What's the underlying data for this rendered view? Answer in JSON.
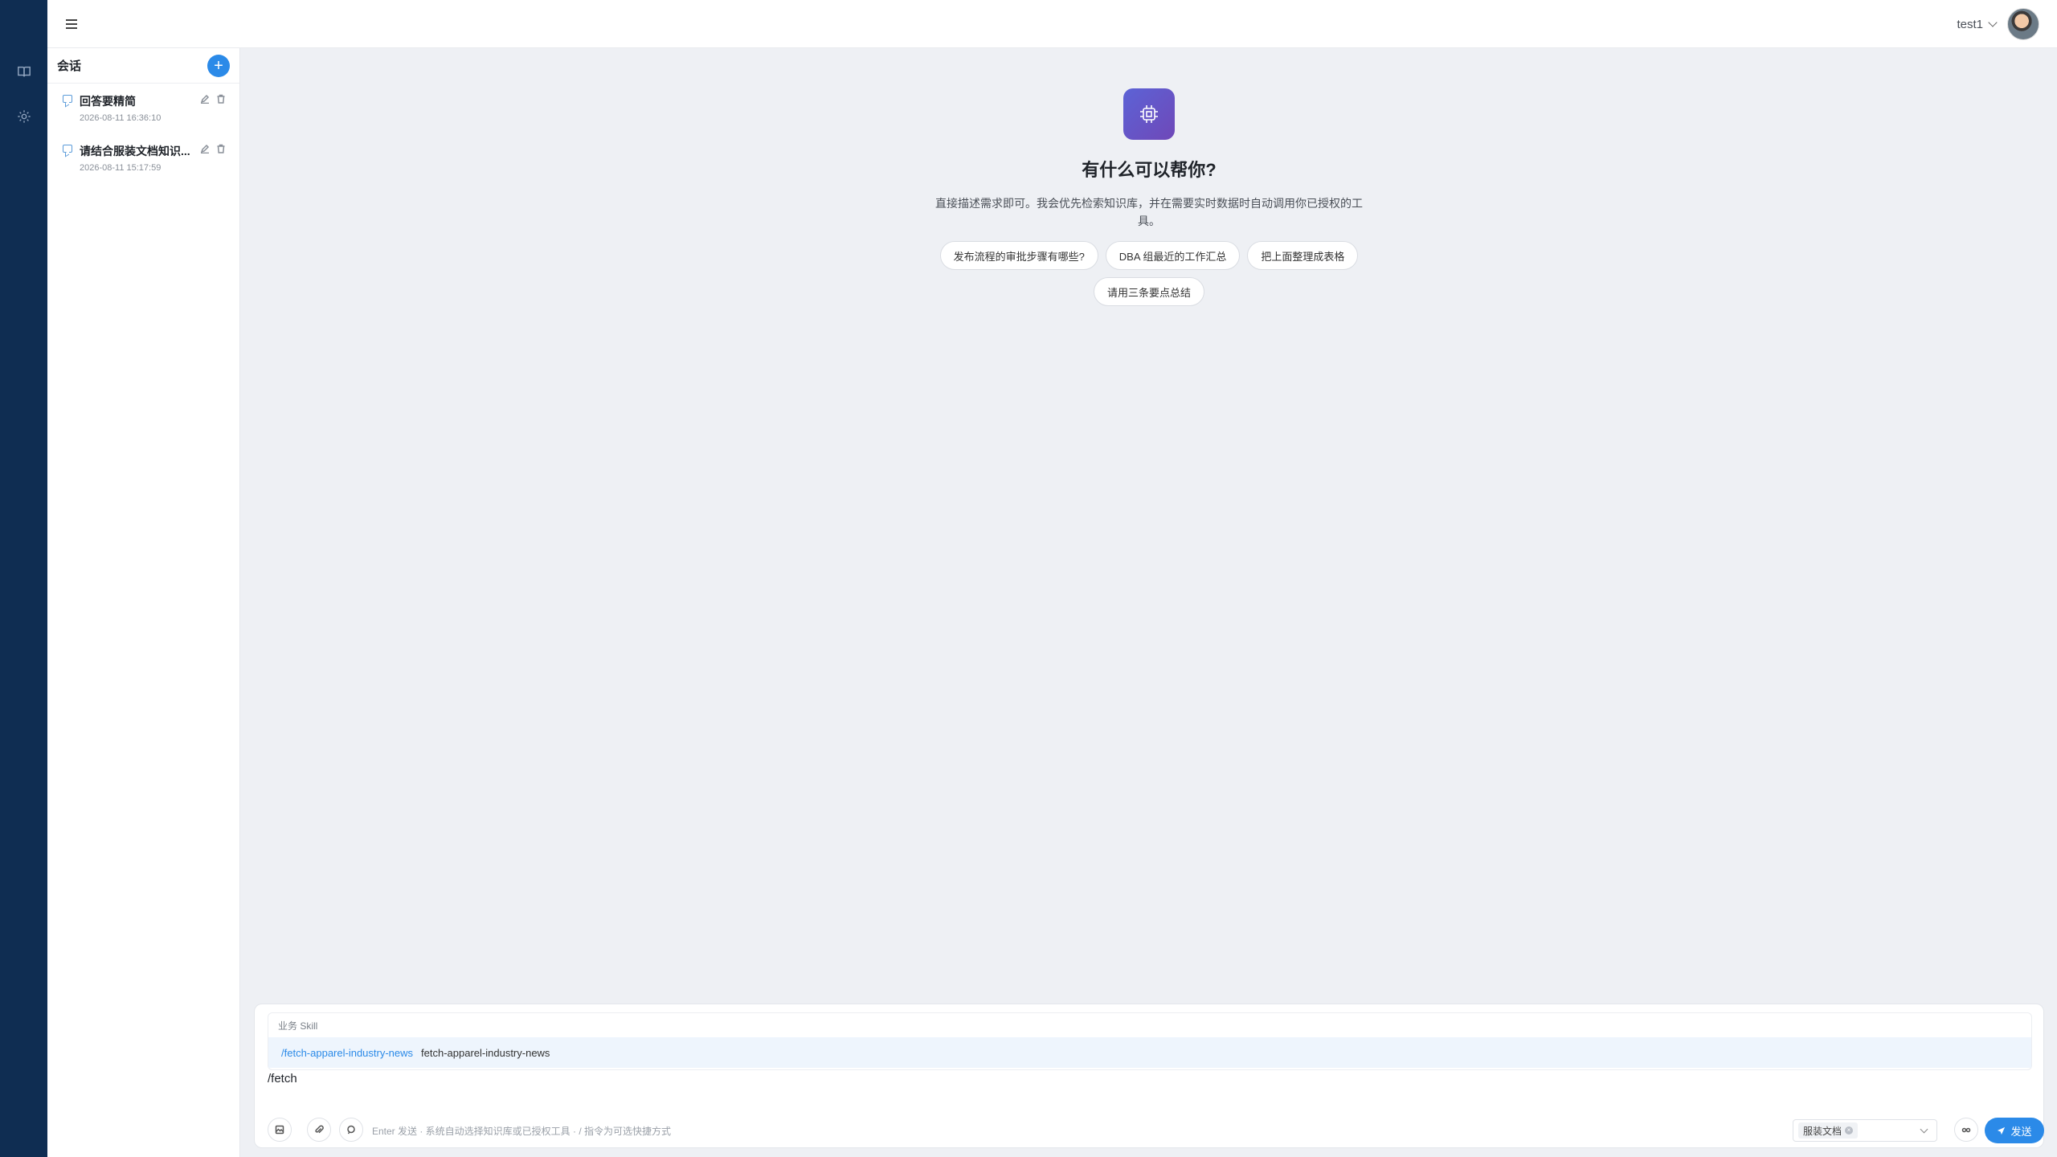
{
  "header": {
    "username": "test1",
    "menu_icon": "menu-icon",
    "avatar_icon": "user-avatar"
  },
  "rail": {
    "items": [
      {
        "icon": "book-icon"
      },
      {
        "icon": "gear-icon"
      }
    ]
  },
  "sessions": {
    "title": "会话",
    "new_label": "+",
    "items": [
      {
        "name": "回答要精简",
        "time": "2026-08-11 16:36:10"
      },
      {
        "name": "请结合服装文档知识...",
        "time": "2026-08-11 15:17:59"
      }
    ]
  },
  "welcome": {
    "icon": "chip-icon",
    "title": "有什么可以帮你?",
    "description": "直接描述需求即可。我会优先检索知识库，并在需要实时数据时自动调用你已授权的工具。",
    "suggestions": [
      "发布流程的审批步骤有哪些?",
      "DBA 组最近的工作汇总",
      "把上面整理成表格",
      "请用三条要点总结"
    ]
  },
  "composer": {
    "skill_group_label": "业务 Skill",
    "skill_command": "/fetch-apparel-industry-news",
    "skill_name": "fetch-apparel-industry-news",
    "input_value": "/fetch",
    "hint": "Enter 发送 · 系统自动选择知识库或已授权工具 · / 指令为可选快捷方式",
    "kb_tag": "服装文档",
    "send_label": "发送"
  },
  "colors": {
    "rail_bg": "#0f2d52",
    "accent": "#2b8ae8",
    "logo_gradient_start": "#5c63d6",
    "logo_gradient_end": "#6f48b8"
  }
}
